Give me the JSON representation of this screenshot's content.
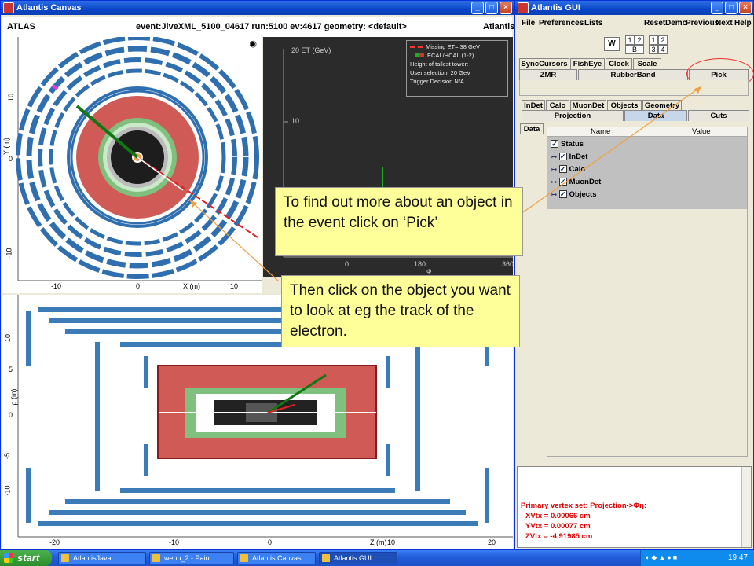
{
  "canvas_window": {
    "title": "Atlantis Canvas",
    "left_label": "ATLAS",
    "event_label": "event:JiveXML_5100_04617 run:5100 ev:4617  geometry: <default>",
    "right_label": "Atlantis"
  },
  "xy_view": {
    "y_axis_label": "Y (m)",
    "x_axis_label": "X (m)",
    "y_ticks": [
      "10",
      "0",
      "-10"
    ],
    "x_ticks": [
      "-10",
      "0",
      "10"
    ]
  },
  "lego_view": {
    "y_label": "20 ET (GeV)",
    "y_tick_10": "10",
    "x_ticks": [
      "0",
      "180",
      "360"
    ],
    "x_axis_label": "Φ",
    "legend": [
      "Missing ET= 38 GeV",
      "ECAL/HCAL (1-2)",
      "Height of tallest tower:",
      "User selection: 20 GeV",
      "Trigger Decision N/A"
    ],
    "colors": {
      "missing_et": "#ff3333",
      "ecal": "#22aa22",
      "hcal": "#cc3333"
    }
  },
  "rz_view": {
    "y_axis_label": "ρ (m)",
    "x_axis_label": "Z (m)",
    "y_ticks": [
      "10",
      "5",
      "0",
      "-5",
      "-10"
    ],
    "x_ticks": [
      "-20",
      "-10",
      "0",
      "10",
      "20"
    ]
  },
  "gui_window": {
    "title": "Atlantis GUI",
    "menus_left": [
      "File",
      "Preferences",
      "Lists"
    ],
    "menus_right": [
      "Reset",
      "Demo",
      "Previous",
      "Next",
      "Help"
    ],
    "layout_buttons": [
      "W",
      "1",
      "2",
      "B",
      "1",
      "2",
      "3",
      "4"
    ],
    "interaction_tabs": [
      "SyncCursors",
      "FishEye",
      "Clock",
      "Scale"
    ],
    "interaction_tabs_row2": [
      "ZMR",
      "RubberBand",
      "Pick"
    ],
    "param_tabs": [
      "InDet",
      "Calo",
      "MuonDet",
      "Objects",
      "Geometry"
    ],
    "param_tabs_row2": [
      "Projection",
      "Data",
      "Cuts"
    ],
    "side_tab": "Data",
    "table_headers": [
      "Name",
      "Value"
    ],
    "tree": [
      {
        "label": "Status"
      },
      {
        "label": "InDet"
      },
      {
        "label": "Calo"
      },
      {
        "label": "MuonDet"
      },
      {
        "label": "Objects"
      }
    ],
    "log_lines": [
      "Primary vertex set: Projection->Φη:",
      "XVtx = 0.00066 cm",
      "YVtx = 0.00077 cm",
      "ZVtx = -4.91985 cm"
    ],
    "log_color": "#dd0000"
  },
  "callouts": {
    "pick": "To find out more about an object in the event click on ‘Pick’",
    "object": "Then click on the object you want to look at eg the track of the electron."
  },
  "taskbar": {
    "start": "start",
    "tasks": [
      "AtlantisJava",
      "wenu_2 - Paint",
      "Atlantis Canvas",
      "Atlantis GUI"
    ],
    "clock": "19:47"
  }
}
